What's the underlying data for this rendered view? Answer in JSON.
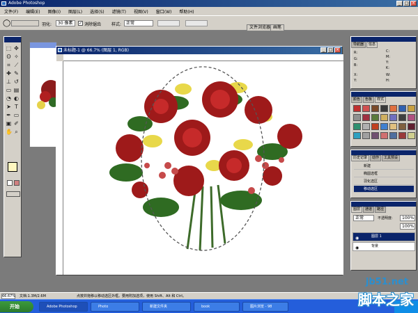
{
  "app": {
    "title": "Adobe Photoshop"
  },
  "menu": {
    "items": [
      "文件(F)",
      "编辑(E)",
      "图像(I)",
      "图层(L)",
      "选择(S)",
      "滤镜(T)",
      "视图(V)",
      "窗口(W)",
      "帮助(H)"
    ]
  },
  "options": {
    "feather_label": "羽化:",
    "feather_value": "30 像素",
    "antialias_label": "消除锯齿",
    "style_label": "样式:",
    "style_value": "正常",
    "tab_file_browser": "文件浏览器",
    "tab_brushes": "画笔"
  },
  "document": {
    "title": "未标题-1 @ 66.7% (图层 1, RGB)"
  },
  "navigator": {
    "tabs": [
      "导航器",
      "信息"
    ],
    "readouts": [
      "R:",
      "G:",
      "B:",
      "C:",
      "M:",
      "Y:",
      "K:",
      "X:",
      "Y:",
      "W:",
      "H:"
    ]
  },
  "swatches": {
    "tabs": [
      "颜色",
      "色板",
      "样式"
    ],
    "colors": [
      "#c03030",
      "#d05050",
      "#7a4a2a",
      "#3a3a3a",
      "#e07040",
      "#3060b0",
      "#c8a040",
      "#909090",
      "#a03040",
      "#5a7a3a",
      "#d0b060",
      "#7070c0",
      "#404040",
      "#b05080",
      "#309070",
      "#b0b0b0",
      "#c04020",
      "#4080d0",
      "#e0c080",
      "#806040",
      "#602030",
      "#30a0c0",
      "#a0a0a0",
      "#705070",
      "#d07070",
      "#4f6f9f",
      "#9a3a3a",
      "#cfcf8f"
    ]
  },
  "history": {
    "tabs": [
      "历史记录",
      "动作",
      "工具预设"
    ],
    "items": [
      "新建",
      "椭圆选框",
      "羽化选区",
      "移动选区"
    ]
  },
  "layers": {
    "tabs": [
      "图层",
      "通道",
      "路径"
    ],
    "mode": "正常",
    "opacity_label": "不透明度:",
    "opacity_value": "100%",
    "fill_value": "100%",
    "items": [
      "图层 1",
      "背景"
    ]
  },
  "status": {
    "zoom": "66.67%",
    "doc_info": "文档:1.3M/2.6M",
    "hint": "点按并拖移以移动选区外框。要用附加选项，使用 Shift、Alt 和 Ctrl。"
  },
  "taskbar": {
    "start": "开始",
    "tasks": [
      "Adobe Photoshop",
      "Photo",
      "新建文件夹",
      "book",
      "图片浏览 - 98"
    ]
  },
  "watermark": {
    "url": "jb51.net",
    "name": "脚本之家"
  }
}
